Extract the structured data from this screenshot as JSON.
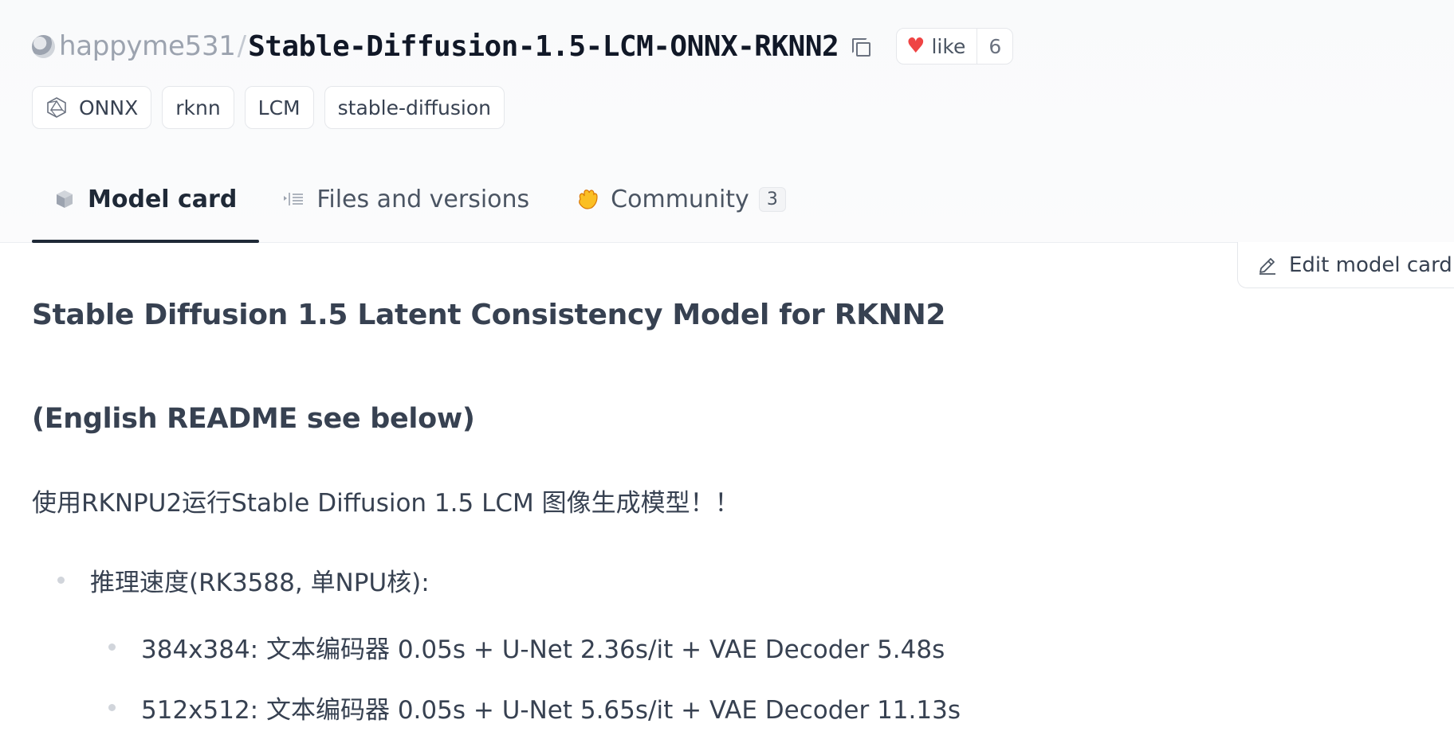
{
  "repo": {
    "owner": "happyme531",
    "separator": "/",
    "name": "Stable-Diffusion-1.5-LCM-ONNX-RKNN2",
    "like_label": "like",
    "like_count": "6"
  },
  "tags": [
    "ONNX",
    "rknn",
    "LCM",
    "stable-diffusion"
  ],
  "tabs": [
    {
      "label": "Model card",
      "icon": "cube-icon",
      "active": true
    },
    {
      "label": "Files and versions",
      "icon": "files-icon"
    },
    {
      "label": "Community",
      "icon": "hand-icon",
      "badge": "3"
    }
  ],
  "edit_button": {
    "label": "Edit model card"
  },
  "content": {
    "title": "Stable Diffusion 1.5 Latent Consistency Model for RKNN2",
    "subtitle": "(English README see below)",
    "intro": "使用RKNPU2运行Stable Diffusion 1.5 LCM 图像生成模型！！",
    "list_heading": "推理速度(RK3588, 单NPU核):",
    "speeds": [
      "384x384: 文本编码器 0.05s + U-Net 2.36s/it + VAE Decoder 5.48s",
      "512x512: 文本编码器 0.05s + U-Net 5.65s/it + VAE Decoder 11.13s"
    ]
  },
  "colors": {
    "heart": "#ef4444",
    "active_tab_underline": "#1f2937",
    "muted_owner": "#9ca3af"
  }
}
